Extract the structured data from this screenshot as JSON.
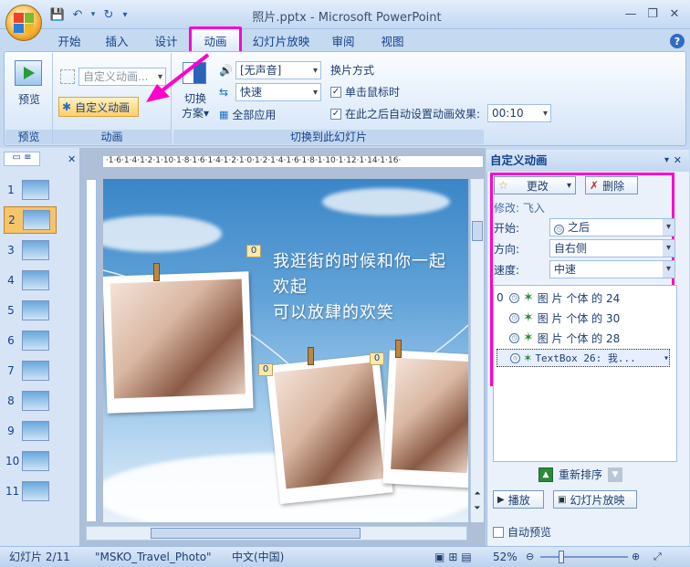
{
  "window": {
    "title": "照片.pptx - Microsoft PowerPoint"
  },
  "tabs": [
    {
      "label": "开始"
    },
    {
      "label": "插入"
    },
    {
      "label": "设计"
    },
    {
      "label": "动画",
      "active": true
    },
    {
      "label": "幻灯片放映"
    },
    {
      "label": "审阅"
    },
    {
      "label": "视图"
    }
  ],
  "ribbon": {
    "preview_group": {
      "button": "预览",
      "label": "预览"
    },
    "animation_group": {
      "animate_combo": "自定义动画...",
      "custom_animation_button": "自定义动画",
      "label": "动画"
    },
    "transition_group": {
      "switch_button_line1": "切换",
      "switch_button_line2": "方案",
      "sound_combo": "[无声音]",
      "speed_combo": "快速",
      "apply_all": "全部应用",
      "advance_title": "换片方式",
      "on_click": "单击鼠标时",
      "auto_after": "在此之后自动设置动画效果:",
      "auto_time": "00:10",
      "label": "切换到此幻灯片"
    }
  },
  "thumbnails": [
    "1",
    "2",
    "3",
    "4",
    "5",
    "6",
    "7",
    "8",
    "9",
    "10",
    "11"
  ],
  "selected_thumbnail": 2,
  "slide": {
    "text_line1": "我逛街的时候和你一起",
    "text_line2": "欢起",
    "text_line3": "可以放肆的欢笑",
    "tag": "0"
  },
  "task_pane": {
    "title": "自定义动画",
    "change_button": "更改",
    "delete_button": "删除",
    "modify_label": "修改: 飞入",
    "start_label": "开始:",
    "start_value": "之后",
    "direction_label": "方向:",
    "direction_value": "自右侧",
    "speed_label": "速度:",
    "speed_value": "中速",
    "items": [
      {
        "index": "0",
        "text": "图 片 个体 的 24"
      },
      {
        "index": "",
        "text": "图 片 个体 的 30"
      },
      {
        "index": "",
        "text": "图 片 个体 的 28"
      },
      {
        "index": "",
        "text": "TextBox 26: 我..."
      }
    ],
    "reorder_label": "重新排序",
    "play_button": "播放",
    "slideshow_button": "幻灯片放映",
    "autopreview_label": "自动预览"
  },
  "statusbar": {
    "slide_info": "幻灯片 2/11",
    "theme": "\"MSKO_Travel_Photo\"",
    "language": "中文(中国)",
    "zoom": "52%"
  },
  "colors": {
    "accent": "#ff00cc",
    "ribbon": "#c5d9f1"
  }
}
